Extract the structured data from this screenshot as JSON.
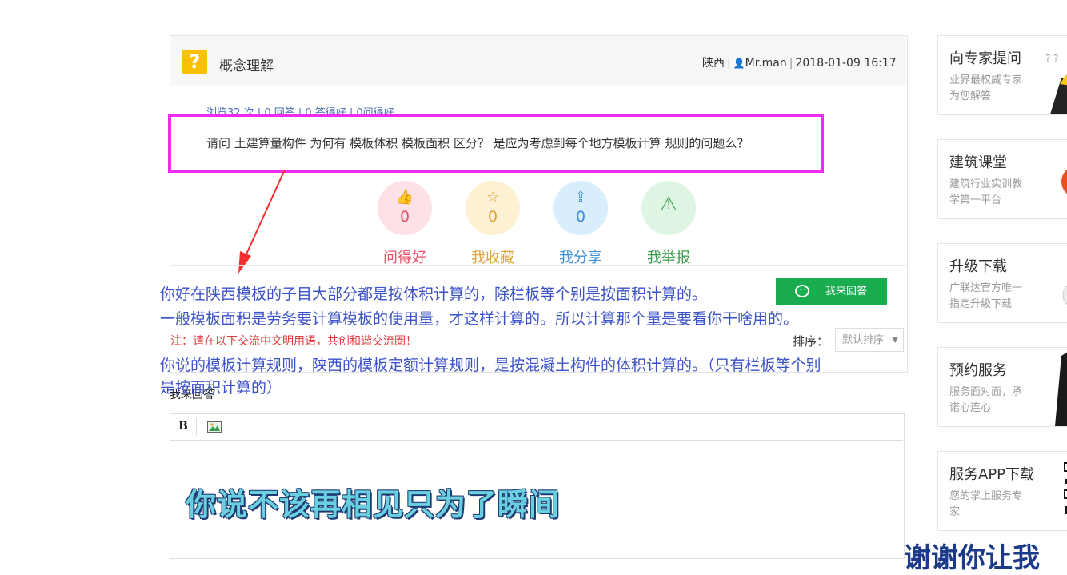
{
  "question": {
    "icon": "question-mark-icon",
    "icon_glyph": "?",
    "title": "概念理解",
    "location": "陕西",
    "user": "Mr.man",
    "datetime": "2018-01-09 16:17:3",
    "stats": "浏览32 次 | 0 回答 | 0 答得好 | 0问得好",
    "text": "请问 土建算量构件 为何有 模板体积 模板面积 区分？  是应为考虑到每个地方模板计算 规则的问题么？"
  },
  "actions": [
    {
      "label": "问得好",
      "count": "0",
      "icon": "thumbs-up-icon",
      "glyph": "👍",
      "color": "#e8546b",
      "bg": "#fde1e6"
    },
    {
      "label": "我收藏",
      "count": "0",
      "icon": "star-icon",
      "glyph": "☆",
      "color": "#e0a23a",
      "bg": "#fdf0d3"
    },
    {
      "label": "我分享",
      "count": "0",
      "icon": "share-icon",
      "glyph": "⇪",
      "color": "#3e8ed8",
      "bg": "#d9eefd"
    },
    {
      "label": "我举报",
      "count": "",
      "icon": "warning-icon",
      "glyph": "⚠",
      "color": "#3a9b4c",
      "bg": "#ddf5e2"
    }
  ],
  "annotation": {
    "line1": "你好在陕西模板的子目大部分都是按体积计算的，除栏板等个别是按面积计算的。",
    "line2": "一般模板面积是劳务要计算模板的使用量，才这样计算的。所以计算那个量是要看你干啥用的。",
    "line3": "你说的模板计算规则，陕西的模板定额计算规则，是按混凝土构件的体积计算的。（只有栏板等个别",
    "line4": "是按面积计算的）"
  },
  "notice": "注：请在以下交流中文明用语，共创和谐交流圈！",
  "sort": {
    "label": "排序：",
    "selected": "默认排序"
  },
  "answer_button": "我来回答",
  "my_answer_label": "我来回答",
  "editor": {
    "bold_label": "B"
  },
  "video_subtitle": "你说不该再相见只为了瞬间",
  "sidebar": [
    {
      "title": "向专家提问",
      "desc": "业界最权威专家为您解答"
    },
    {
      "title": "建筑课堂",
      "desc": "建筑行业实训教学第一平台"
    },
    {
      "title": "升级下载",
      "desc": "广联达官方唯一指定升级下载"
    },
    {
      "title": "预约服务",
      "desc": "服务面对面，承诺心连心"
    },
    {
      "title": "服务APP下载",
      "desc": "您的掌上服务专家"
    }
  ],
  "bottom_partial_text": "谢谢你让我"
}
